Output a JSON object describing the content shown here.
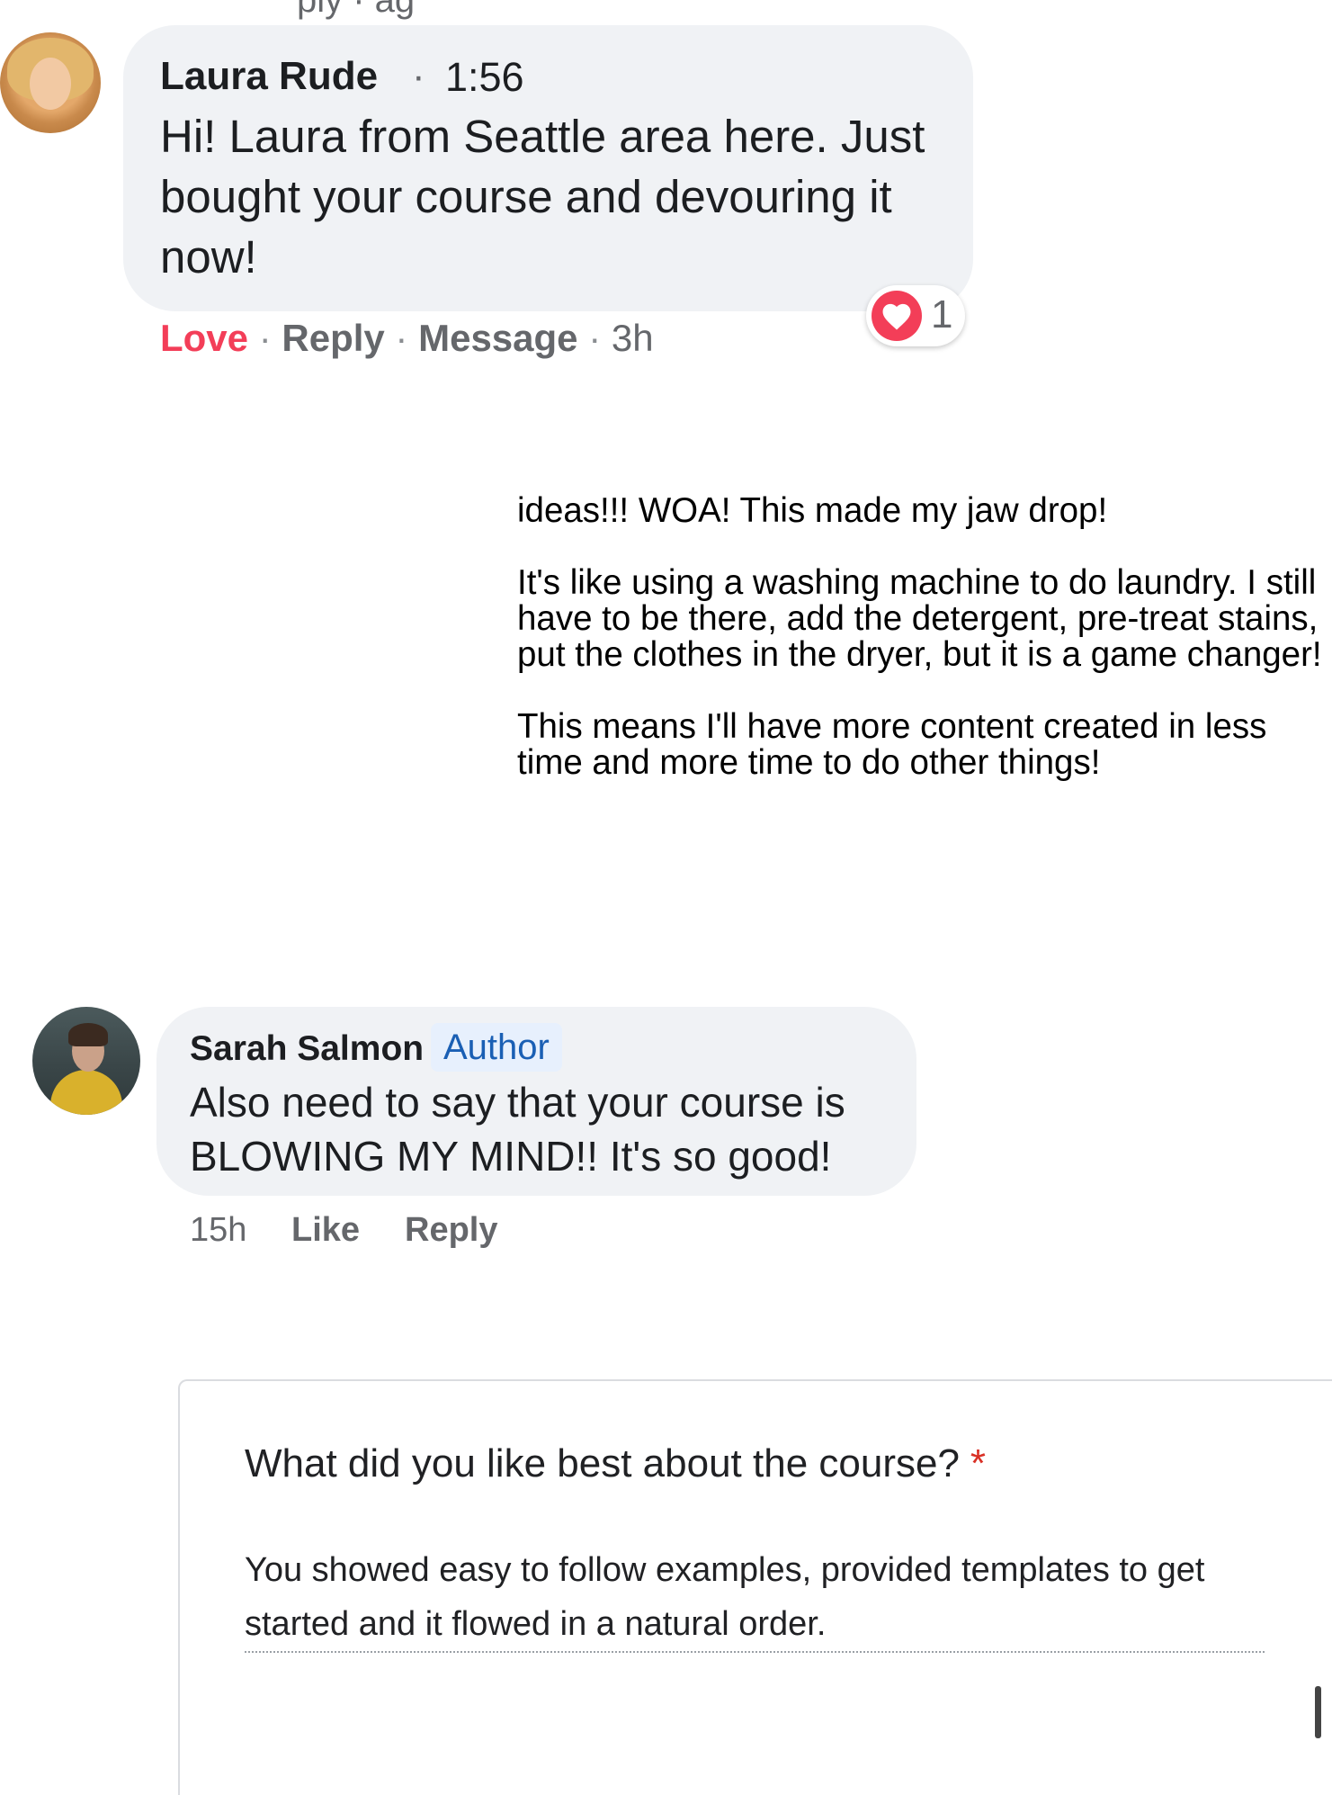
{
  "top_remnant": "ply · ag",
  "comment1": {
    "author": "Laura Rude",
    "separator": "·",
    "time": "1:56",
    "text": "Hi! Laura from Seattle area here. Just bought your course and devouring it now!",
    "actions": {
      "love": "Love",
      "reply": "Reply",
      "message": "Message",
      "age": "3h",
      "separator": "·"
    },
    "reaction": {
      "icon": "heart-icon",
      "count": "1"
    }
  },
  "pasted": {
    "para1": "ideas!!! WOA! This made my jaw drop!",
    "para2": "It's like using a washing machine to do laundry. I still have to be there, add the detergent, pre-treat stains, put the clothes in the dryer, but it is a game changer!",
    "para3": "This means I'll have more content created in less time and more time to do other things!"
  },
  "comment2": {
    "author": "Sarah Salmon",
    "badge": "Author",
    "text": "Also need to say that your course is BLOWING MY MIND!! It's so good!",
    "age": "15h",
    "like": "Like",
    "reply": "Reply"
  },
  "form": {
    "question": "What did you like best about the course?",
    "required_mark": "*",
    "answer": "You showed easy to follow examples, provided templates to get started and it flowed in a natural order."
  },
  "colors": {
    "bubble": "#f0f2f5",
    "love": "#f33e58",
    "author_badge_bg": "#e7f0fd",
    "author_badge_text": "#1a5fb4",
    "required": "#d93025"
  }
}
